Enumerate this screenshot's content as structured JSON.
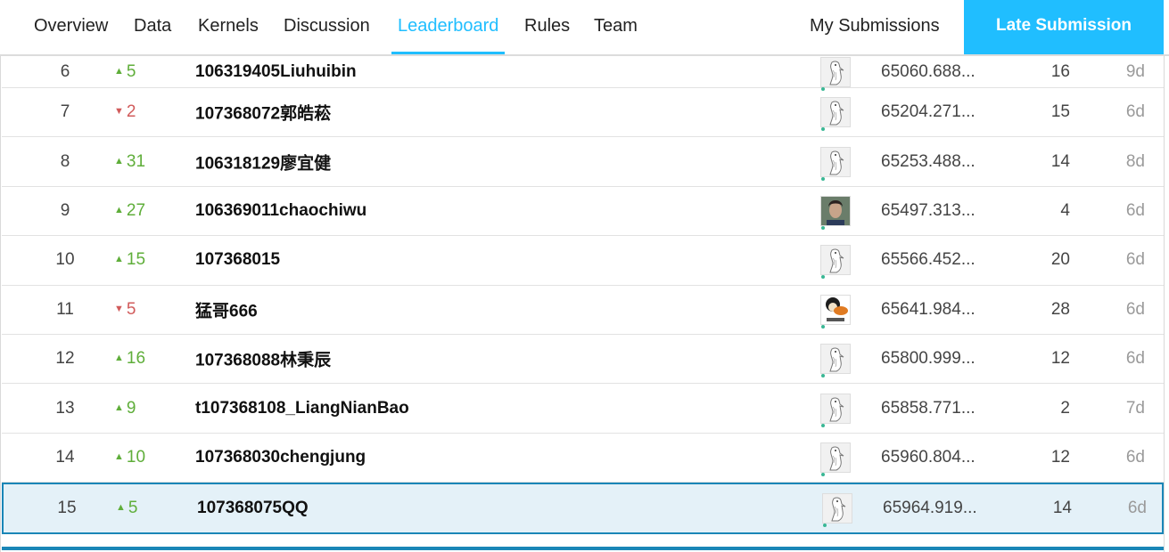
{
  "nav": {
    "tabs": [
      {
        "label": "Overview"
      },
      {
        "label": "Data"
      },
      {
        "label": "Kernels"
      },
      {
        "label": "Discussion"
      },
      {
        "label": "Leaderboard",
        "active": true
      },
      {
        "label": "Rules"
      },
      {
        "label": "Team"
      }
    ],
    "my_submissions": "My Submissions",
    "late_submission": "Late Submission",
    "accent_color": "#20beff"
  },
  "leaderboard": {
    "rows": [
      {
        "rank": "6",
        "delta": "5",
        "dir": "up",
        "team": "106319405Liuhuibin",
        "avatar": "goose-icon",
        "score": "65060.688...",
        "entries": "16",
        "last": "9d"
      },
      {
        "rank": "7",
        "delta": "2",
        "dir": "down",
        "team": "107368072郭皓菘",
        "avatar": "goose-icon",
        "score": "65204.271...",
        "entries": "15",
        "last": "6d"
      },
      {
        "rank": "8",
        "delta": "31",
        "dir": "up",
        "team": "106318129廖宜健",
        "avatar": "goose-icon",
        "score": "65253.488...",
        "entries": "14",
        "last": "8d"
      },
      {
        "rank": "9",
        "delta": "27",
        "dir": "up",
        "team": "106369011chaochiwu",
        "avatar": "photo-avatar",
        "score": "65497.313...",
        "entries": "4",
        "last": "6d"
      },
      {
        "rank": "10",
        "delta": "15",
        "dir": "up",
        "team": "107368015",
        "avatar": "goose-icon",
        "score": "65566.452...",
        "entries": "20",
        "last": "6d"
      },
      {
        "rank": "11",
        "delta": "5",
        "dir": "down",
        "team": "猛哥666",
        "avatar": "cartoon-avatar",
        "score": "65641.984...",
        "entries": "28",
        "last": "6d"
      },
      {
        "rank": "12",
        "delta": "16",
        "dir": "up",
        "team": "107368088林秉辰",
        "avatar": "goose-icon",
        "score": "65800.999...",
        "entries": "12",
        "last": "6d"
      },
      {
        "rank": "13",
        "delta": "9",
        "dir": "up",
        "team": "t107368108_LiangNianBao",
        "avatar": "goose-icon",
        "score": "65858.771...",
        "entries": "2",
        "last": "7d"
      },
      {
        "rank": "14",
        "delta": "10",
        "dir": "up",
        "team": "107368030chengjung",
        "avatar": "goose-icon",
        "score": "65960.804...",
        "entries": "12",
        "last": "6d"
      },
      {
        "rank": "15",
        "delta": "5",
        "dir": "up",
        "team": "107368075QQ",
        "avatar": "goose-icon",
        "score": "65964.919...",
        "entries": "14",
        "last": "6d",
        "selected": true
      }
    ],
    "colors": {
      "up": "#5fae3a",
      "down": "#d15b5b",
      "selected_bg": "#e4f1f8",
      "selected_border": "#1a86b7"
    }
  }
}
